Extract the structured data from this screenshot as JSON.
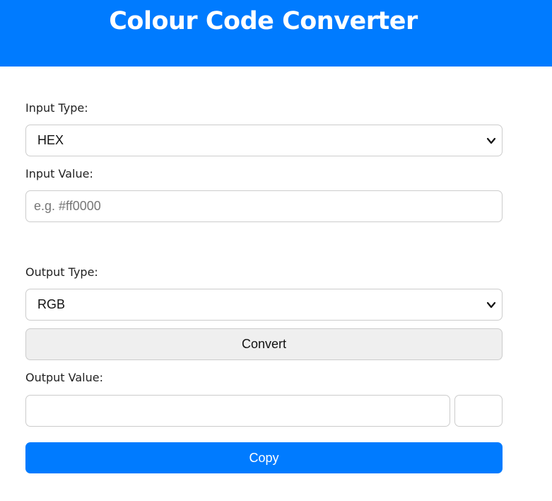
{
  "header": {
    "title": "Colour Code Converter"
  },
  "form": {
    "input_type_label": "Input Type:",
    "input_type_selected": "HEX",
    "input_value_label": "Input Value:",
    "input_value_placeholder": "e.g. #ff0000",
    "input_value": "",
    "output_type_label": "Output Type:",
    "output_type_selected": "RGB",
    "convert_label": "Convert",
    "output_value_label": "Output Value:",
    "output_value": "",
    "copy_label": "Copy"
  },
  "icons": {
    "select_arrow": "chevron-down-icon"
  },
  "colors": {
    "accent": "#007bff",
    "header_text": "#ffffff",
    "convert_bg": "#efefef",
    "border": "#cccccc"
  }
}
